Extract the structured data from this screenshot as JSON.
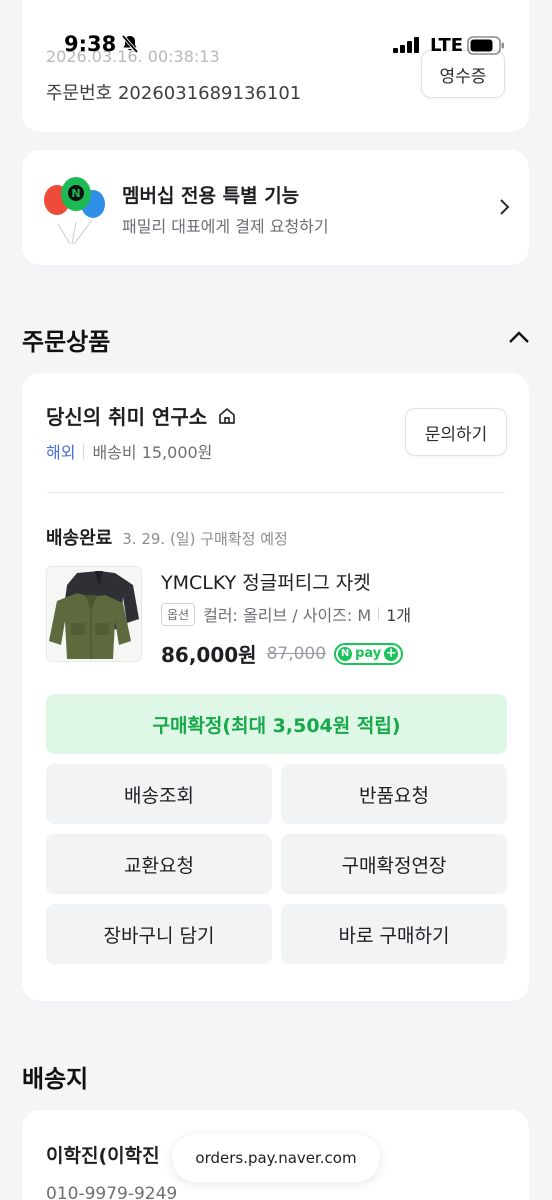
{
  "status_bar": {
    "time": "9:38",
    "network": "LTE"
  },
  "order": {
    "date": "2026.03.16. 00:38:13",
    "number_label": "주문번호",
    "number": "2026031689136101",
    "receipt_button": "영수증"
  },
  "membership": {
    "title": "멤버십 전용 특별 기능",
    "subtitle": "패밀리 대표에게 결제 요청하기"
  },
  "ordered_products": {
    "section_title": "주문상품",
    "store": {
      "name": "당신의 취미 연구소",
      "region": "해외",
      "shipping_fee": "배송비 15,000원",
      "inquiry_button": "문의하기"
    },
    "delivery": {
      "status": "배송완료",
      "note": "3. 29. (일) 구매확정 예정"
    },
    "item": {
      "name": "YMCLKY 정글퍼티그 자켓",
      "option_tag": "옵션",
      "option": "컬러: 올리브 / 사이즈: M",
      "quantity": "1개",
      "price": "86,000원",
      "original_price": "87,000",
      "npay_label": "pay",
      "npay_n": "N"
    },
    "confirm_button": "구매확정(최대 3,504원 적립)",
    "actions": [
      "배송조회",
      "반품요청",
      "교환요청",
      "구매확정연장",
      "장바구니 담기",
      "바로 구매하기"
    ]
  },
  "shipping_address": {
    "section_title": "배송지",
    "recipient": "이학진(이학진",
    "phone": "010-9979-9249"
  },
  "browser": {
    "url": "orders.pay.naver.com"
  },
  "colors": {
    "accent_green": "#17a84a",
    "confirm_bg": "#dff7e6",
    "overseas_blue": "#4b6fd6",
    "background": "#f4f5f7"
  }
}
